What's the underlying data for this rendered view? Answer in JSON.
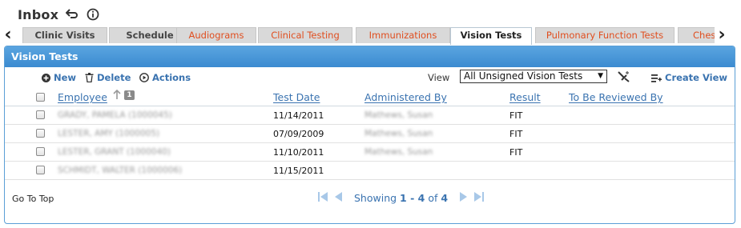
{
  "app": {
    "title": "Inbox"
  },
  "tabs": {
    "items": [
      {
        "label": "Clinic Visits"
      },
      {
        "label": "Schedule"
      },
      {
        "label": "Audiograms"
      },
      {
        "label": "Clinical Testing"
      },
      {
        "label": "Immunizations"
      },
      {
        "label": "Vision Tests"
      },
      {
        "label": "Pulmonary Function Tests"
      },
      {
        "label": "Chest"
      }
    ],
    "active": "Vision Tests"
  },
  "panel": {
    "title": "Vision Tests"
  },
  "toolbar": {
    "new_label": "New",
    "delete_label": "Delete",
    "actions_label": "Actions",
    "view_label": "View",
    "view_selected": "All Unsigned Vision Tests",
    "create_view_label": "Create View"
  },
  "table": {
    "columns": [
      "Employee",
      "Test Date",
      "Administered By",
      "Result",
      "To Be Reviewed By"
    ],
    "sort_badge": "1",
    "rows": [
      {
        "employee": "GRADY, PAMELA (1000045)",
        "test_date": "11/14/2011",
        "administered_by": "Mathews, Susan",
        "result": "FIT",
        "reviewer": ""
      },
      {
        "employee": "LESTER, AMY (1000005)",
        "test_date": "07/09/2009",
        "administered_by": "Mathews, Susan",
        "result": "FIT",
        "reviewer": ""
      },
      {
        "employee": "LESTER, GRANT (1000040)",
        "test_date": "11/10/2011",
        "administered_by": "Mathews, Susan",
        "result": "FIT",
        "reviewer": ""
      },
      {
        "employee": "SCHMIDT, WALTER (1000006)",
        "test_date": "11/15/2011",
        "administered_by": "",
        "result": "",
        "reviewer": ""
      }
    ]
  },
  "footer": {
    "go_to_top": "Go To Top",
    "showing_prefix": "Showing",
    "range": "1 - 4",
    "of_word": "of",
    "total": "4"
  },
  "colors": {
    "accent": "#3a73b0",
    "header_blue": "#4b98d8",
    "tab_orange": "#e04e1f"
  }
}
